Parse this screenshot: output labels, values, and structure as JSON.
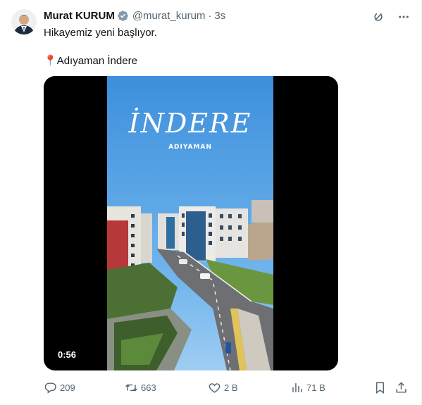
{
  "tweet": {
    "author": {
      "name": "Murat KURUM",
      "handle": "@murat_kurum",
      "separator": "·",
      "time": "3s"
    },
    "text_line1": "Hikayemiz yeni başlıyor.",
    "location_pin": "📍",
    "location": "Adıyaman İndere",
    "video": {
      "title_overlay": "İNDERE",
      "subtitle_overlay": "ADIYAMAN",
      "duration": "0:56"
    },
    "stats": {
      "replies": "209",
      "reposts": "663",
      "likes": "2 B",
      "views": "71 B"
    },
    "icons": {
      "verified": "verified-badge-icon",
      "grok": "grok-icon",
      "more": "more-icon",
      "reply": "reply-icon",
      "repost": "repost-icon",
      "like": "heart-icon",
      "views": "views-icon",
      "bookmark": "bookmark-icon",
      "share": "share-icon"
    },
    "colors": {
      "text": "#0f1419",
      "secondary": "#536471",
      "sky": "#4f9fe2",
      "grass": "#5f8a3a"
    }
  }
}
